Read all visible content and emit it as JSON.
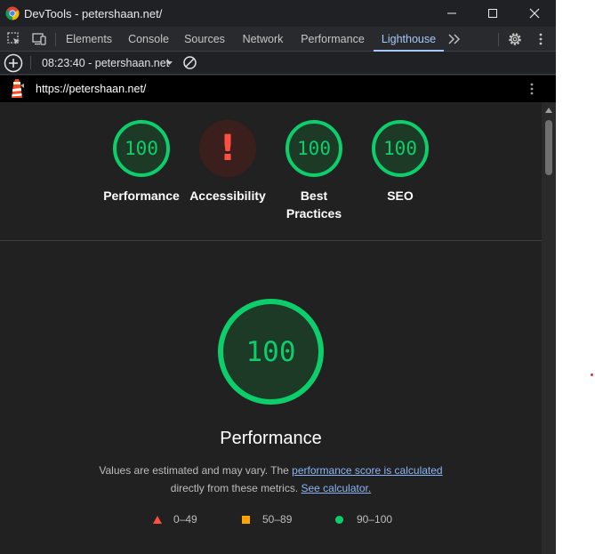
{
  "window": {
    "title": "DevTools - petershaan.net/"
  },
  "tabs": [
    {
      "label": "Elements"
    },
    {
      "label": "Console"
    },
    {
      "label": "Sources"
    },
    {
      "label": "Network"
    },
    {
      "label": "Performance"
    },
    {
      "label": "Lighthouse"
    }
  ],
  "toolbar": {
    "report_label": "08:23:40 - petershaan.net"
  },
  "url_bar": {
    "url": "https://petershaan.net/"
  },
  "categories": [
    {
      "label": "Performance",
      "score": "100"
    },
    {
      "label": "Accessibility",
      "score": "!"
    },
    {
      "label": "Best Practices",
      "label_line1": "Best",
      "label_line2": "Practices",
      "score": "100"
    },
    {
      "label": "SEO",
      "score": "100"
    }
  ],
  "performance": {
    "score": "100",
    "title": "Performance",
    "desc_text": "Values are estimated and may vary. The ",
    "desc_link": "performance score is calculated",
    "desc_text2": "directly from these metrics. ",
    "desc_link2": "See calculator."
  },
  "legend": [
    {
      "range": "0–49",
      "color": "#ff4e42"
    },
    {
      "range": "50–89",
      "color": "#ffa400"
    },
    {
      "range": "90–100",
      "color": "#0cce6b"
    }
  ]
}
